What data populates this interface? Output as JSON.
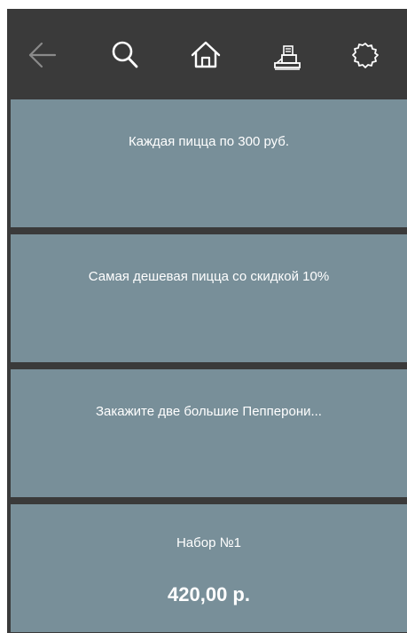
{
  "toolbar": {
    "buttons": [
      {
        "name": "back",
        "icon": "arrow-left-icon"
      },
      {
        "name": "search",
        "icon": "search-icon"
      },
      {
        "name": "home",
        "icon": "home-icon"
      },
      {
        "name": "delivery",
        "icon": "delivery-icon"
      },
      {
        "name": "settings",
        "icon": "settings-gear-icon"
      }
    ],
    "colors": {
      "background": "#3a3a3a",
      "icon": "#ffffff",
      "icon_disabled": "#8a8a8a"
    }
  },
  "promotions": [
    {
      "title": "Каждая пицца по 300 руб."
    },
    {
      "title": "Самая дешевая пицца со скидкой 10%"
    },
    {
      "title": "Закажите две большие Пепперони..."
    },
    {
      "title": "Набор №1",
      "price": "420,00 р."
    }
  ],
  "colors": {
    "card": "#788f99",
    "separator": "#3a3a3a",
    "text": "#ffffff"
  }
}
